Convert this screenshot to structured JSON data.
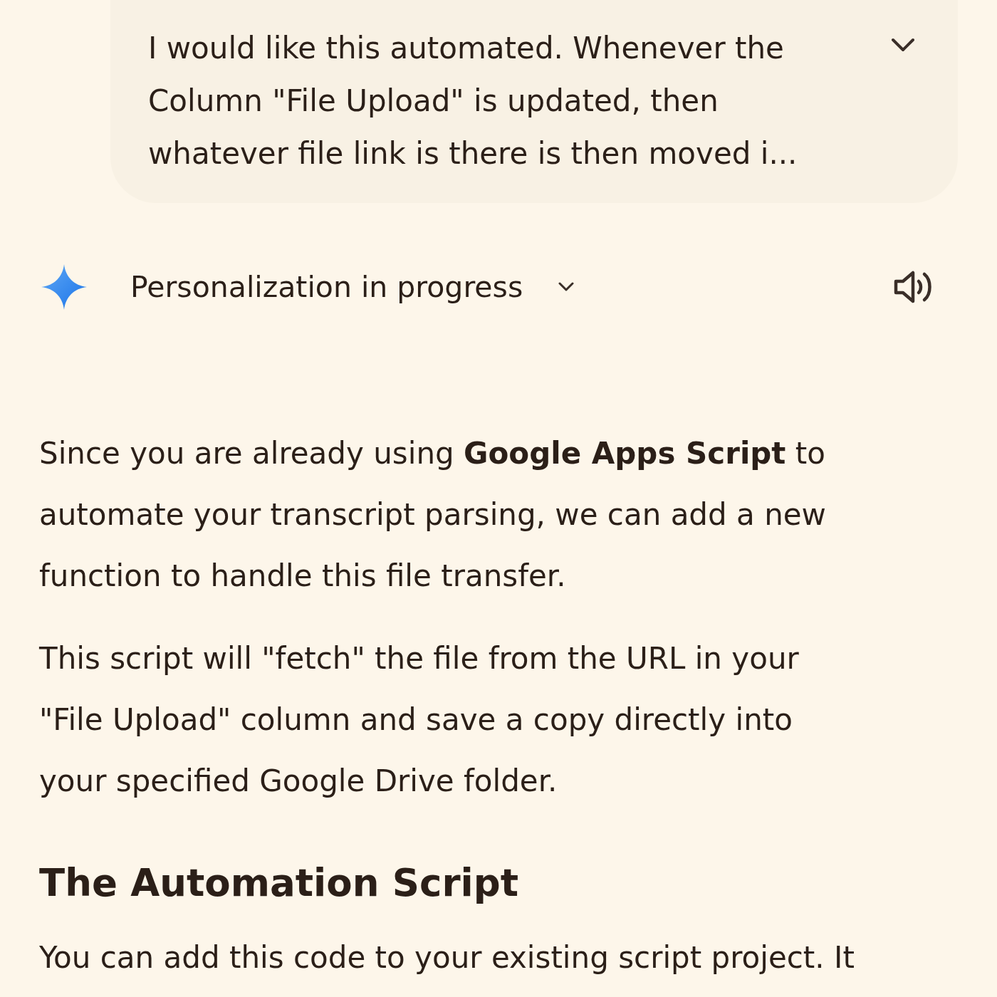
{
  "user_message": {
    "text": "I would like this automated. Whenever the Column \"File Upload\" is updated, then whatever file link is there is then moved i...",
    "expanded": false
  },
  "response_header": {
    "status": "Personalization in progress"
  },
  "response": {
    "blocks": [
      {
        "kind": "paragraph",
        "text": "Since you are already using **Google Apps Script** to automate your transcript parsing, we can add a new function to handle this file transfer."
      },
      {
        "kind": "paragraph",
        "text": "This script will \"fetch\" the file from the URL in your \"File Upload\" column and save a copy directly into your specified Google Drive folder."
      },
      {
        "kind": "heading",
        "text": "The Automation Script"
      },
      {
        "kind": "paragraph",
        "text": "You can add this code to your existing script project. It"
      }
    ]
  }
}
